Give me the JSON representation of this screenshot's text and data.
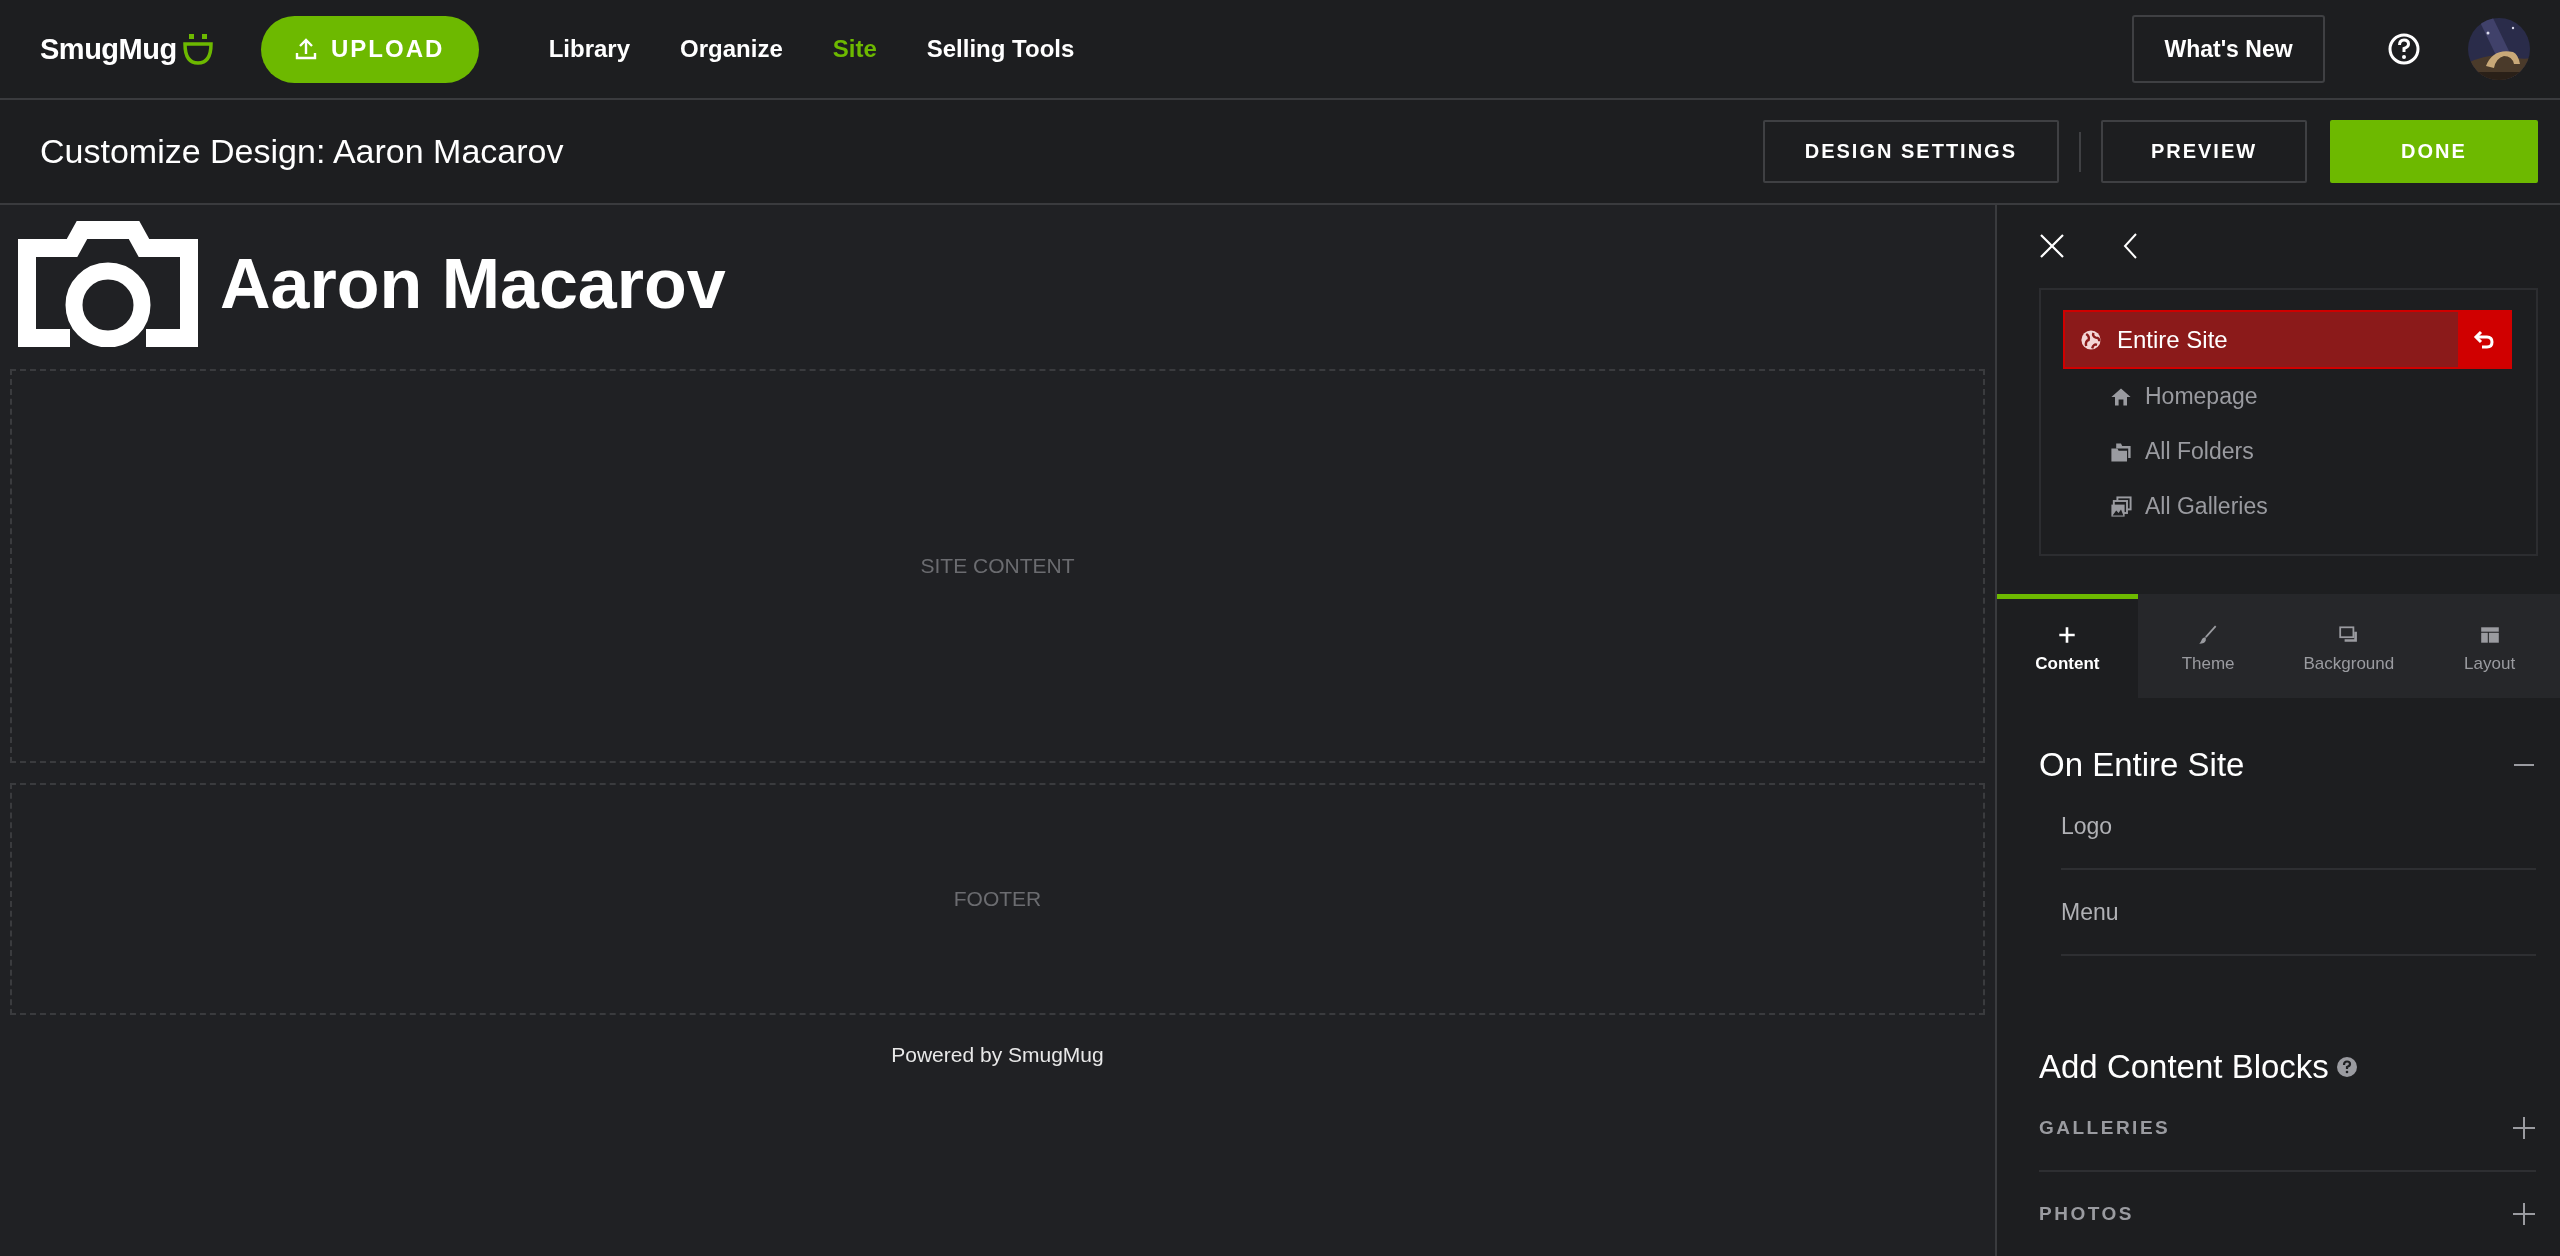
{
  "topbar": {
    "brand": "SmugMug",
    "upload": "UPLOAD",
    "nav": [
      {
        "label": "Library",
        "selected": false
      },
      {
        "label": "Organize",
        "selected": false
      },
      {
        "label": "Site",
        "selected": true
      },
      {
        "label": "Selling Tools",
        "selected": false
      }
    ],
    "whats_new": "What's New"
  },
  "toolbar": {
    "title": "Customize Design: Aaron Macarov",
    "buttons": [
      {
        "label": "DESIGN SETTINGS",
        "kind": "outline"
      },
      {
        "label": "PREVIEW",
        "kind": "outline"
      },
      {
        "label": "DONE",
        "kind": "primary"
      }
    ]
  },
  "canvas": {
    "site_name": "Aaron Macarov",
    "regions": [
      {
        "label": "SITE CONTENT",
        "kind": "content"
      },
      {
        "label": "FOOTER",
        "kind": "footer"
      }
    ],
    "powered_by": "Powered by SmugMug"
  },
  "panel": {
    "scopes": [
      {
        "label": "Entire Site",
        "selected": true,
        "kind": "globe",
        "children": [
          {
            "label": "Homepage",
            "selected": false,
            "kind": "home"
          },
          {
            "label": "All Folders",
            "selected": false,
            "kind": "folders"
          },
          {
            "label": "All Galleries",
            "selected": false,
            "kind": "galleries"
          }
        ]
      }
    ],
    "tabs": [
      {
        "label": "Content",
        "selected": true,
        "kind": "content"
      },
      {
        "label": "Theme",
        "selected": false,
        "kind": "theme"
      },
      {
        "label": "Background",
        "selected": false,
        "kind": "background"
      },
      {
        "label": "Layout",
        "selected": false,
        "kind": "layout"
      }
    ],
    "section": {
      "title": "On Entire Site",
      "expanded": true,
      "items": [
        "Logo",
        "Menu"
      ]
    },
    "blocks": {
      "title": "Add Content Blocks",
      "items": [
        "GALLERIES",
        "PHOTOS"
      ]
    }
  }
}
